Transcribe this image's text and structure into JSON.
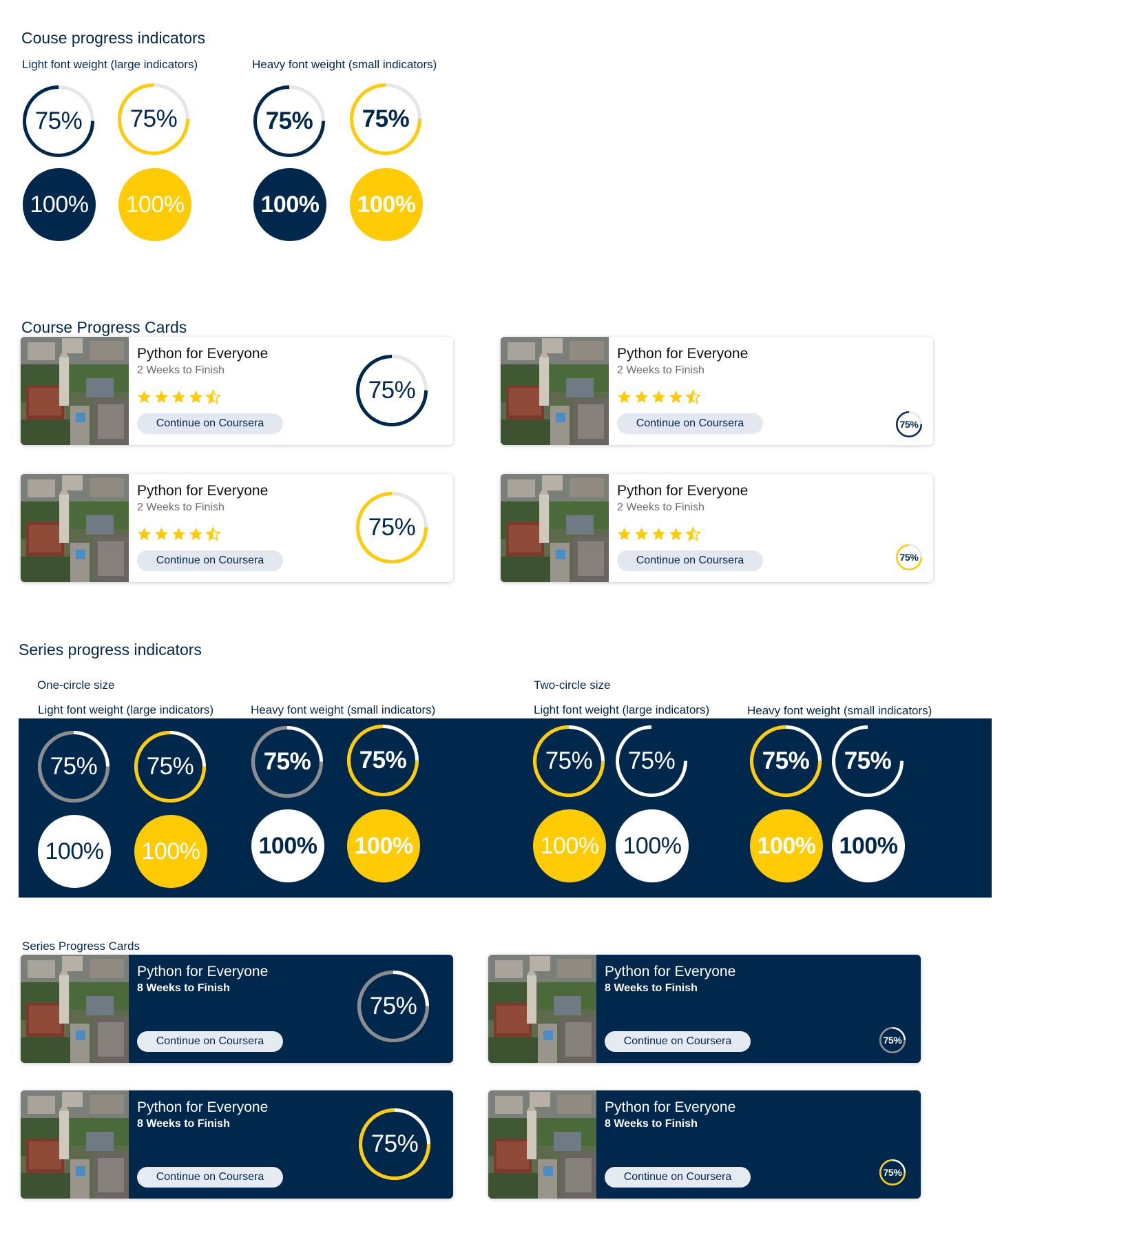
{
  "colors": {
    "navy": "#00274c",
    "gold": "#ffcb05",
    "gray_track": "#e6e6e6",
    "gray_arc": "#8c8c8c",
    "white": "#ffffff"
  },
  "course_indicators": {
    "title": "Couse progress indicators",
    "light_label": "Light font weight (large indicators)",
    "heavy_label": "Heavy font weight (small indicators)",
    "partial": {
      "value": 0.75,
      "label": "75%"
    },
    "complete": {
      "value": 1.0,
      "label": "100%"
    }
  },
  "course_cards": {
    "title": "Course Progress Cards",
    "card": {
      "course_name": "Python for Everyone",
      "time_left": "2 Weeks to Finish",
      "rating": 4.5,
      "button_label": "Continue on Coursera",
      "progress": 0.75,
      "progress_label": "75%"
    }
  },
  "series_indicators": {
    "title": "Series progress indicators",
    "one_circle_label": "One-circle size",
    "two_circle_label": "Two-circle size",
    "light_label": "Light font weight (large indicators)",
    "heavy_label": "Heavy font weight (small indicators)",
    "partial": {
      "value": 0.75,
      "label": "75%"
    },
    "complete": {
      "value": 1.0,
      "label": "100%"
    }
  },
  "series_cards": {
    "title": "Series Progress Cards",
    "card": {
      "course_name": "Python for Everyone",
      "time_left": "8 Weeks to Finish",
      "button_label": "Continue on Coursera",
      "progress": 0.75,
      "progress_label": "75%"
    }
  }
}
